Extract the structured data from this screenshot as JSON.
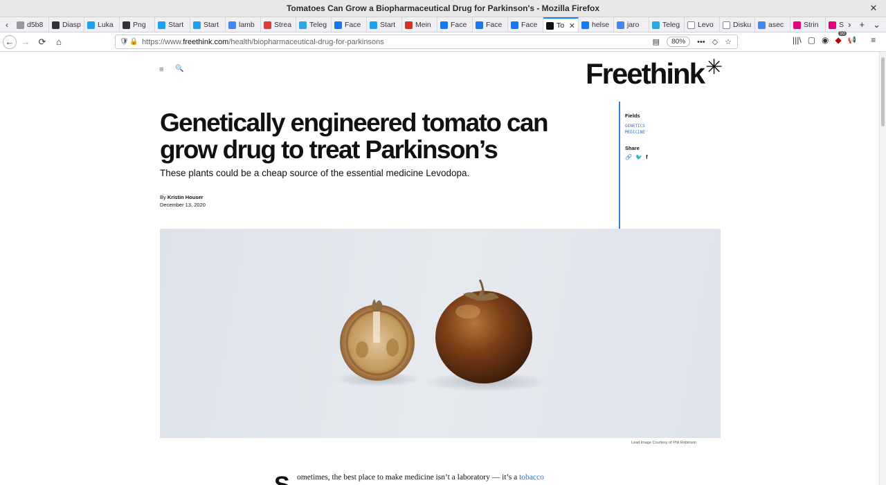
{
  "window": {
    "title": "Tomatoes Can Grow a Biopharmaceutical Drug for Parkinson's - Mozilla Firefox",
    "close": "✕"
  },
  "tabs": [
    {
      "label": "d5b8",
      "icon": "page-icon",
      "color": "#999999"
    },
    {
      "label": "Diasp",
      "icon": "diaspora-icon",
      "color": "#333333"
    },
    {
      "label": "Luka",
      "icon": "twitter-icon",
      "color": "#1da1f2"
    },
    {
      "label": "Png",
      "icon": "diaspora-icon",
      "color": "#333333"
    },
    {
      "label": "Start",
      "icon": "twitter-icon",
      "color": "#1da1f2"
    },
    {
      "label": "Start",
      "icon": "twitter-icon",
      "color": "#1da1f2"
    },
    {
      "label": "lamb",
      "icon": "google-icon",
      "color": "#4285f4"
    },
    {
      "label": "Strea",
      "icon": "stream-icon",
      "color": "#e53935"
    },
    {
      "label": "Teleg",
      "icon": "telegram-icon",
      "color": "#2ca5e0"
    },
    {
      "label": "Face",
      "icon": "facebook-icon",
      "color": "#1877f2"
    },
    {
      "label": "Start",
      "icon": "twitter-icon",
      "color": "#1da1f2"
    },
    {
      "label": "Mein",
      "icon": "gmail-icon",
      "color": "#d93025"
    },
    {
      "label": "Face",
      "icon": "facebook-icon",
      "color": "#1877f2"
    },
    {
      "label": "Face",
      "icon": "facebook-icon",
      "color": "#1877f2"
    },
    {
      "label": "Face",
      "icon": "facebook-icon",
      "color": "#1877f2"
    },
    {
      "label": "To",
      "icon": "freethink-icon",
      "color": "#111111",
      "active": true
    },
    {
      "label": "helse",
      "icon": "facebook-icon",
      "color": "#1877f2"
    },
    {
      "label": "jaro",
      "icon": "google-icon",
      "color": "#4285f4"
    },
    {
      "label": "Teleg",
      "icon": "telegram-icon",
      "color": "#2ca5e0"
    },
    {
      "label": "Levo",
      "icon": "wikipedia-icon",
      "color": "#ffffff"
    },
    {
      "label": "Disku",
      "icon": "wikipedia-icon",
      "color": "#ffffff"
    },
    {
      "label": "asec",
      "icon": "google-icon",
      "color": "#4285f4"
    },
    {
      "label": "Strin",
      "icon": "string-icon",
      "color": "#e6007e"
    },
    {
      "label": "Strin",
      "icon": "string-icon",
      "color": "#e6007e"
    }
  ],
  "tab_tools": {
    "overflow": "›",
    "new_tab": "+",
    "list": "⌄"
  },
  "nav": {
    "back": "←",
    "forward": "→",
    "reload": "⟳",
    "home": "⌂",
    "url_prefix": "https://www.",
    "url_host": "freethink.com",
    "url_path": "/health/biopharmaceutical-drug-for-parkinsons",
    "zoom": "80%",
    "reader": "▤",
    "more": "•••",
    "pocket": "◇",
    "bookmark": "☆",
    "library": "|||\\",
    "sidebar": "▢",
    "account": "◉",
    "ublock_count": "10",
    "megaphone": "📢",
    "menu": "≡"
  },
  "page": {
    "menu_icon": "≡",
    "search_icon": "🔍",
    "logo": "Freethink",
    "logo_star": "✳",
    "headline": "Genetically engineered tomato can grow drug to treat Parkinson’s",
    "dek": "These plants could be a cheap source of the essential medicine Levodopa.",
    "by": "By",
    "author": "Kristin Houser",
    "date": "December 13, 2020",
    "fields_label": "Fields",
    "fields": [
      "GENETICS",
      "MEDICINE"
    ],
    "share_label": "Share",
    "share_icons": [
      "🔗",
      "🐦",
      "f"
    ],
    "caption": "Lead Image Courtesy of Phil Robinson",
    "dropcap": "S",
    "body_text": "ometimes, the best place to make medicine isn’t a laboratory — it’s a",
    "body_link": "tobacco"
  }
}
